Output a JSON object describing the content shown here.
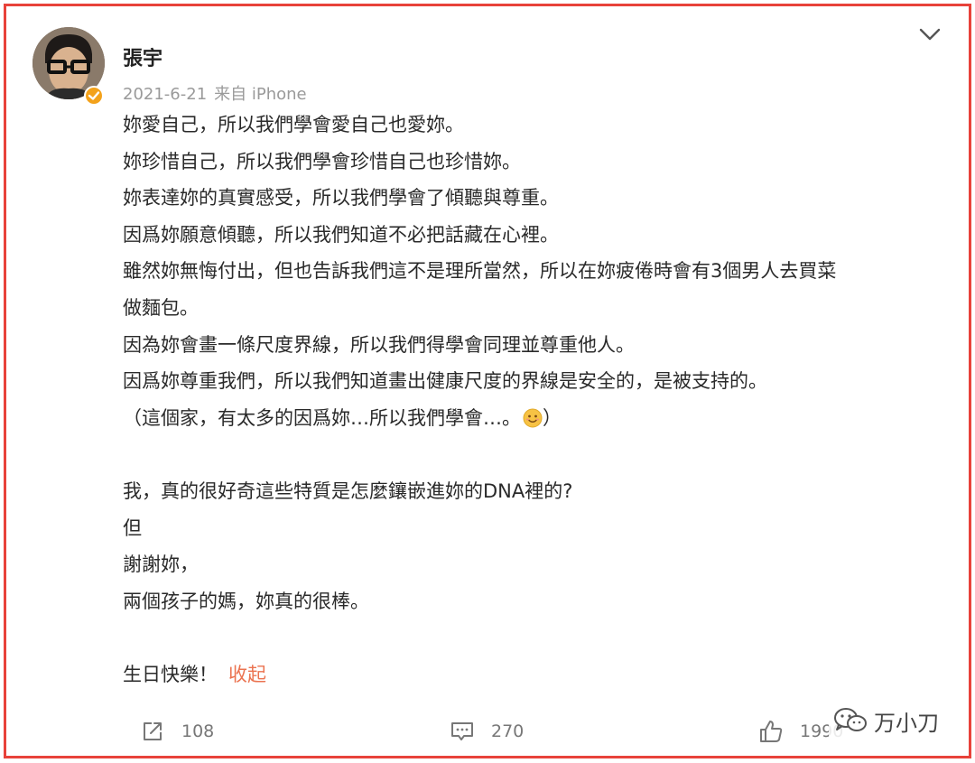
{
  "post": {
    "author_name": "張宇",
    "date": "2021-6-21",
    "source": "来自 iPhone",
    "lines": [
      "妳愛自己，所以我們學會愛自己也愛妳。",
      "妳珍惜自己，所以我們學會珍惜自己也珍惜妳。",
      "妳表達妳的真實感受，所以我們學會了傾聽與尊重。",
      "因爲妳願意傾聽，所以我們知道不必把話藏在心裡。",
      "雖然妳無悔付出，但也告訴我們這不是理所當然，所以在妳疲倦時會有3個男人去買菜",
      "做麵包。",
      "因為妳會畫一條尺度界線，所以我們得學會同理並尊重他人。",
      "因爲妳尊重我們，所以我們知道畫出健康尺度的界線是安全的，是被支持的。",
      "（這個家，有太多的因爲妳…所以我們學會…。",
      "",
      "我，真的很好奇這些特質是怎麼鑲嵌進妳的DNA裡的?",
      "但",
      "謝謝妳，",
      "兩個孩子的媽，妳真的很棒。",
      "",
      "生日快樂！"
    ],
    "line9_tail": "）",
    "collapse_label": "收起"
  },
  "actions": {
    "repost_count": "108",
    "comment_count": "270",
    "like_count": "1990"
  },
  "watermark": {
    "text": "万小刀"
  },
  "colors": {
    "frame": "#e8423a",
    "link": "#eb7350",
    "verified_badge": "#f3a21b"
  },
  "icons": [
    "chevron-down-icon",
    "verified-badge-icon",
    "smile-emoji-icon",
    "share-icon",
    "comment-icon",
    "thumbs-up-icon",
    "wechat-icon"
  ]
}
